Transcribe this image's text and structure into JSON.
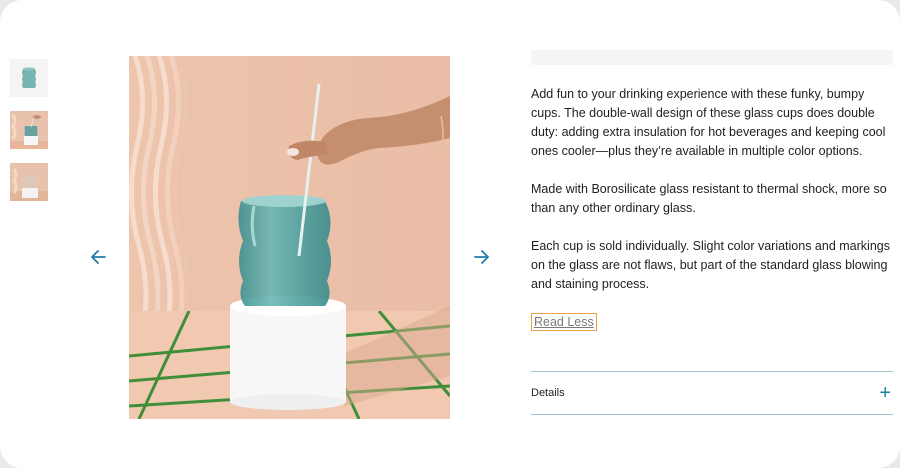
{
  "product": {
    "description": [
      "Add fun to your drinking experience with these funky, bumpy cups. The double-wall design of these glass cups does double duty: adding extra insulation for hot beverages and keeping cool ones cooler—plus they’re available in multiple color options.",
      "Made with Borosilicate glass resistant to thermal shock, more so than any other ordinary glass.",
      "Each cup is sold individually. Slight color variations and markings on the glass are not flaws, but part of the standard glass blowing and staining process."
    ],
    "read_less_label": "Read Less",
    "details_label": "Details",
    "details_toggle": "+"
  },
  "gallery": {
    "thumbnail_count": 3,
    "icons": {
      "prev": "arrow-left-icon",
      "next": "arrow-right-icon"
    },
    "accent_color": "#1f7fa8"
  }
}
